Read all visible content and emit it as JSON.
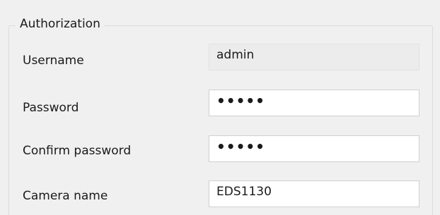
{
  "section": {
    "title": "Authorization"
  },
  "fields": {
    "username": {
      "label": "Username",
      "value": "admin"
    },
    "password": {
      "label": "Password",
      "value": "•••••"
    },
    "confirm_password": {
      "label": "Confirm password",
      "value": "•••••"
    },
    "camera_name": {
      "label": "Camera name",
      "value": "EDS1130"
    }
  }
}
